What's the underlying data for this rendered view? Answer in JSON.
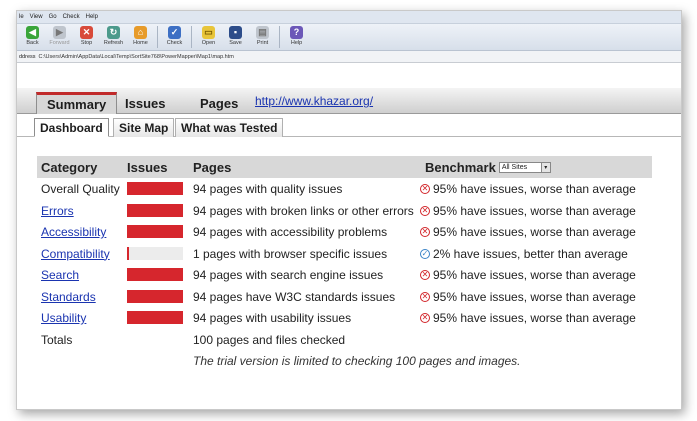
{
  "menubar": {
    "items": [
      "le",
      "View",
      "Go",
      "Check",
      "Help"
    ]
  },
  "toolbar": {
    "buttons": [
      {
        "label": "Back",
        "icon": "back-arrow-icon"
      },
      {
        "label": "Forward",
        "icon": "forward-arrow-icon"
      },
      {
        "label": "Stop",
        "icon": "stop-icon"
      },
      {
        "label": "Refresh",
        "icon": "refresh-icon"
      },
      {
        "label": "Home",
        "icon": "home-icon"
      },
      {
        "label": "Check",
        "icon": "check-icon"
      },
      {
        "label": "Open",
        "icon": "open-folder-icon"
      },
      {
        "label": "Save",
        "icon": "save-disk-icon"
      },
      {
        "label": "Print",
        "icon": "print-icon"
      },
      {
        "label": "Help",
        "icon": "help-icon"
      }
    ]
  },
  "address": {
    "label": "ddress",
    "value": "C:\\Users\\Admin\\AppData\\Local\\Temp\\SortSite768\\PowerMapper\\Map1\\map.htm"
  },
  "tabs": {
    "main": [
      "Summary",
      "Issues",
      "Pages"
    ],
    "active": "Summary",
    "site_link": "http://www.khazar.org/"
  },
  "subtabs": {
    "items": [
      "Dashboard",
      "Site Map",
      "What was Tested"
    ],
    "active": "Dashboard"
  },
  "report": {
    "headers": {
      "category": "Category",
      "issues": "Issues",
      "pages": "Pages",
      "benchmark": "Benchmark"
    },
    "benchmark_select": "All Sites",
    "rows": [
      {
        "category": "Overall Quality",
        "link": false,
        "issue_fraction": 1.0,
        "pages": "94 pages with quality issues",
        "benchmark": "95% have issues, worse than average",
        "status": "bad"
      },
      {
        "category": "Errors",
        "link": true,
        "issue_fraction": 1.0,
        "pages": "94 pages with broken links or other errors",
        "benchmark": "95% have issues, worse than average",
        "status": "bad"
      },
      {
        "category": "Accessibility",
        "link": true,
        "issue_fraction": 1.0,
        "pages": "94 pages with accessibility problems",
        "benchmark": "95% have issues, worse than average",
        "status": "bad"
      },
      {
        "category": "Compatibility",
        "link": true,
        "issue_fraction": 0.03,
        "pages": "1 pages with browser specific issues",
        "benchmark": "2% have issues, better than average",
        "status": "good"
      },
      {
        "category": "Search",
        "link": true,
        "issue_fraction": 1.0,
        "pages": "94 pages with search engine issues",
        "benchmark": "95% have issues, worse than average",
        "status": "bad"
      },
      {
        "category": "Standards",
        "link": true,
        "issue_fraction": 1.0,
        "pages": "94 pages have W3C standards issues",
        "benchmark": "95% have issues, worse than average",
        "status": "bad"
      },
      {
        "category": "Usability",
        "link": true,
        "issue_fraction": 1.0,
        "pages": "94 pages with usability issues",
        "benchmark": "95% have issues, worse than average",
        "status": "bad"
      }
    ],
    "totals": {
      "label": "Totals",
      "value": "100 pages and files checked"
    },
    "trial_note": "The trial version is limited to checking 100 pages and images."
  },
  "colors": {
    "bar_red": "#d6262d",
    "link_blue": "#1a34b0",
    "bad": "#d2252a",
    "good": "#3a83c7",
    "active_tab_top": "#c12a2a"
  }
}
